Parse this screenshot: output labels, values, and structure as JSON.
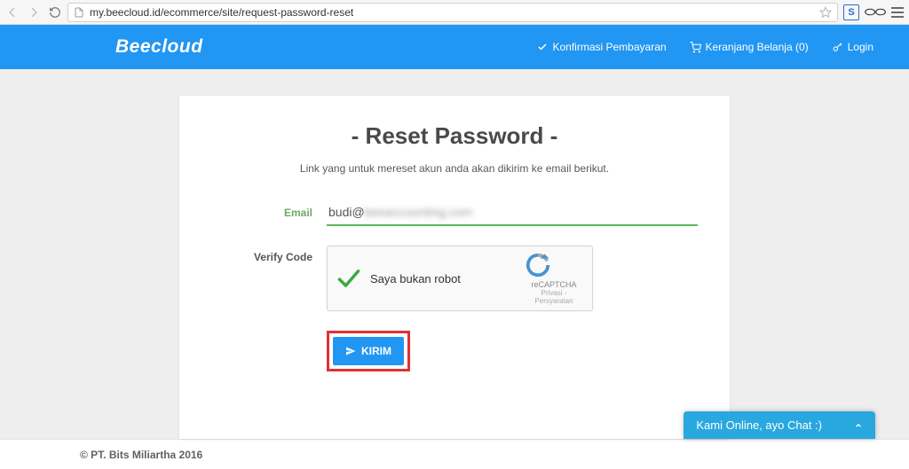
{
  "browser": {
    "url": "my.beecloud.id/ecommerce/site/request-password-reset"
  },
  "header": {
    "brand": "Beecloud",
    "nav": {
      "payment_confirm": "Konfirmasi Pembayaran",
      "cart": "Keranjang Belanja (0)",
      "login": "Login"
    }
  },
  "form": {
    "title": "- Reset Password -",
    "subtitle": "Link yang untuk mereset akun anda akan dikirim ke email berikut.",
    "email_label": "Email",
    "email_value_prefix": "budi@",
    "email_value_obscured": "beeaccounting.com",
    "verify_label": "Verify Code",
    "recaptcha_text": "Saya bukan robot",
    "recaptcha_brand": "reCAPTCHA",
    "recaptcha_links": "Privasi - Persyaratan",
    "submit_label": "KIRIM"
  },
  "footer": {
    "copyright": "© PT. Bits Miliartha 2016"
  },
  "chat": {
    "text": "Kami Online, ayo Chat :)"
  }
}
